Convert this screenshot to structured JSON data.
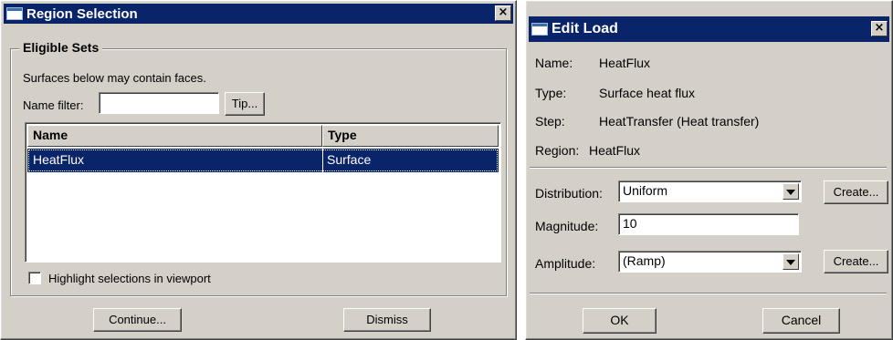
{
  "region_dialog": {
    "title": "Region Selection",
    "close_glyph": "×",
    "group_label": "Eligible Sets",
    "hint": "Surfaces below may contain faces.",
    "name_filter_label": "Name filter:",
    "name_filter_value": "",
    "tip_label": "Tip...",
    "columns": [
      "Name",
      "Type"
    ],
    "rows": [
      {
        "name": "HeatFlux",
        "type": "Surface",
        "selected": true
      }
    ],
    "highlight_label": "Highlight selections in viewport",
    "highlight_checked": false,
    "continue_label": "Continue...",
    "dismiss_label": "Dismiss"
  },
  "edit_load_dialog": {
    "title": "Edit Load",
    "close_glyph": "×",
    "name_label": "Name:",
    "name_value": "HeatFlux",
    "type_label": "Type:",
    "type_value": "Surface heat flux",
    "step_label": "Step:",
    "step_value": "HeatTransfer (Heat transfer)",
    "region_label": "Region:",
    "region_value": "HeatFlux",
    "distribution_label": "Distribution:",
    "distribution_value": "Uniform",
    "create_distribution_label": "Create...",
    "magnitude_label": "Magnitude:",
    "magnitude_value": "10",
    "amplitude_label": "Amplitude:",
    "amplitude_value": "(Ramp)",
    "create_amplitude_label": "Create...",
    "ok_label": "OK",
    "cancel_label": "Cancel"
  },
  "colors": {
    "title_bar": "#0a246a",
    "face": "#d4d0c8",
    "selection": "#0a246a"
  }
}
